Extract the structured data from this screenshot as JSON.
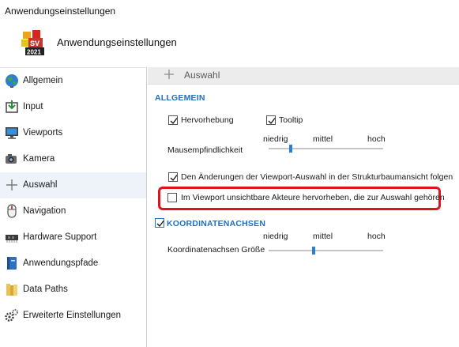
{
  "window": {
    "title": "Anwendungseinstellungen"
  },
  "header": {
    "title": "Anwendungseinstellungen",
    "logo_icon": "app-logo-2021-icon",
    "logo_year": "2021"
  },
  "sidebar": {
    "items": [
      {
        "label": "Allgemein",
        "icon": "globe-icon"
      },
      {
        "label": "Input",
        "icon": "input-icon"
      },
      {
        "label": "Viewports",
        "icon": "monitor-icon"
      },
      {
        "label": "Kamera",
        "icon": "camera-icon"
      },
      {
        "label": "Auswahl",
        "icon": "plus-icon",
        "active": true
      },
      {
        "label": "Navigation",
        "icon": "mouse-icon"
      },
      {
        "label": "Hardware Support",
        "icon": "chip-icon"
      },
      {
        "label": "Anwendungspfade",
        "icon": "book-icon"
      },
      {
        "label": "Data Paths",
        "icon": "folder-icon"
      },
      {
        "label": "Erweiterte Einstellungen",
        "icon": "gears-icon"
      }
    ]
  },
  "panel": {
    "title": "Auswahl",
    "allgemein": {
      "title": "ALLGEMEIN",
      "hervorhebung": {
        "label": "Hervorhebung",
        "checked": true
      },
      "tooltip": {
        "label": "Tooltip",
        "checked": true
      },
      "sensitivity": {
        "label": "Mausempfindlichkeit",
        "ticks": [
          "niedrig",
          "mittel",
          "hoch"
        ],
        "value_fraction": 0.19
      },
      "follow_changes": {
        "label": "Den Änderungen der Viewport-Auswahl in der Strukturbaumansicht folgen",
        "checked": true
      },
      "highlight_hidden": {
        "label": "Im Viewport unsichtbare Akteure hervorheben, die zur Auswahl gehören",
        "checked": false
      }
    },
    "axes": {
      "title": "KOORDINATENACHSEN",
      "checked": true,
      "size": {
        "label": "Koordinatenachsen Größe",
        "ticks": [
          "niedrig",
          "mittel",
          "hoch"
        ],
        "value_fraction": 0.39
      }
    }
  },
  "colors": {
    "accent": "#1f6fc4",
    "highlight_border": "#e0121b",
    "slider_thumb": "#2b7fd6",
    "active_item": "#eef3fa"
  }
}
